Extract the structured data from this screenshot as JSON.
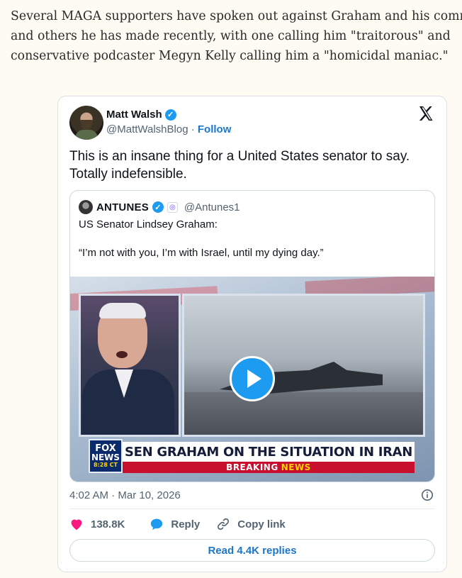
{
  "article": {
    "lines": [
      "Several MAGA supporters have spoken out against Graham and his comments",
      "and others he has made recently, with one calling him \"traitorous\" and",
      "conservative podcaster Megyn Kelly calling him a \"homicidal maniac.\""
    ]
  },
  "tweet": {
    "author_name": "Matt Walsh",
    "handle": "@MattWalshBlog",
    "separator": "·",
    "follow_label": "Follow",
    "text": "This is an insane thing for a United States senator to say. Totally indefensible.",
    "timestamp": "4:02 AM · Mar 10, 2026",
    "likes": "138.8K",
    "reply_label": "Reply",
    "copy_link_label": "Copy link",
    "read_replies_label": "Read 4.4K replies",
    "icons": {
      "x_logo": "x-logo-icon",
      "verified": "verified-badge-icon",
      "info": "info-icon",
      "heart": "heart-icon",
      "reply": "speech-bubble-icon",
      "link": "link-icon",
      "play": "play-icon"
    },
    "colors": {
      "accent": "#1d9bf0",
      "heart": "#f91880",
      "link": "#1d77c9"
    }
  },
  "quote": {
    "author_name": "ANTUNES",
    "handle": "@Antunes1",
    "line1": "US Senator Lindsey Graham:",
    "line2": "“I’m not with you, I’m with Israel, until my dying day.”",
    "video": {
      "headline": "SEN GRAHAM ON THE SITUATION IN IRAN",
      "breaking": "BREAKING",
      "news": "NEWS",
      "logo_line1": "FOX",
      "logo_line2": "NEWS",
      "logo_time": "8:28 CT"
    }
  }
}
